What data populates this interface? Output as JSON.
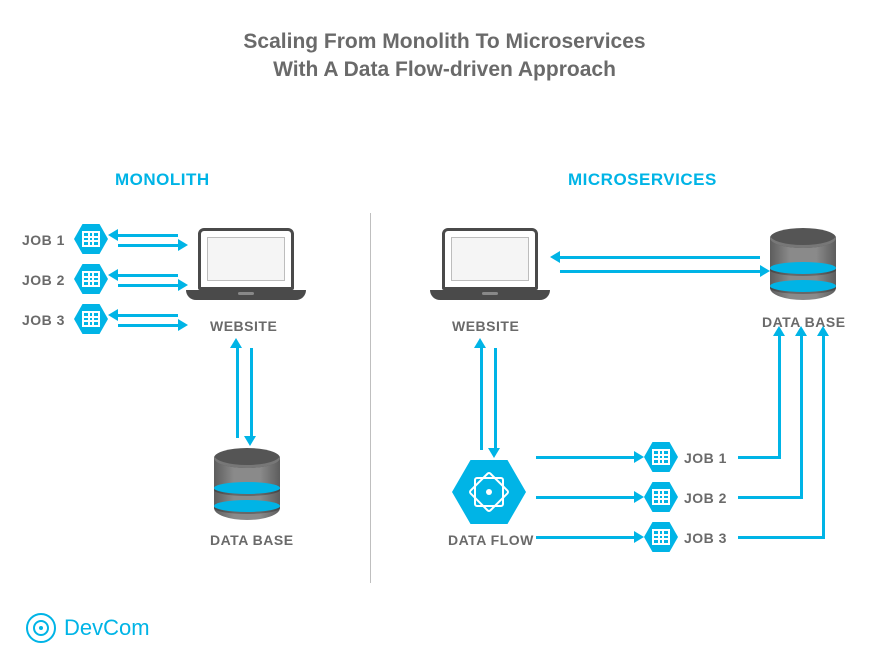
{
  "title_line1": "Scaling From Monolith To Microservices",
  "title_line2": "With A Data Flow-driven Approach",
  "monolith": {
    "heading": "MONOLITH",
    "website_label": "WEBSITE",
    "database_label": "DATA BASE",
    "jobs": [
      "JOB 1",
      "JOB 2",
      "JOB 3"
    ]
  },
  "microservices": {
    "heading": "MICROSERVICES",
    "website_label": "WEBSITE",
    "database_label": "DATA BASE",
    "dataflow_label": "DATA FLOW",
    "jobs": [
      "JOB 1",
      "JOB 2",
      "JOB 3"
    ]
  },
  "brand": "DevCom"
}
